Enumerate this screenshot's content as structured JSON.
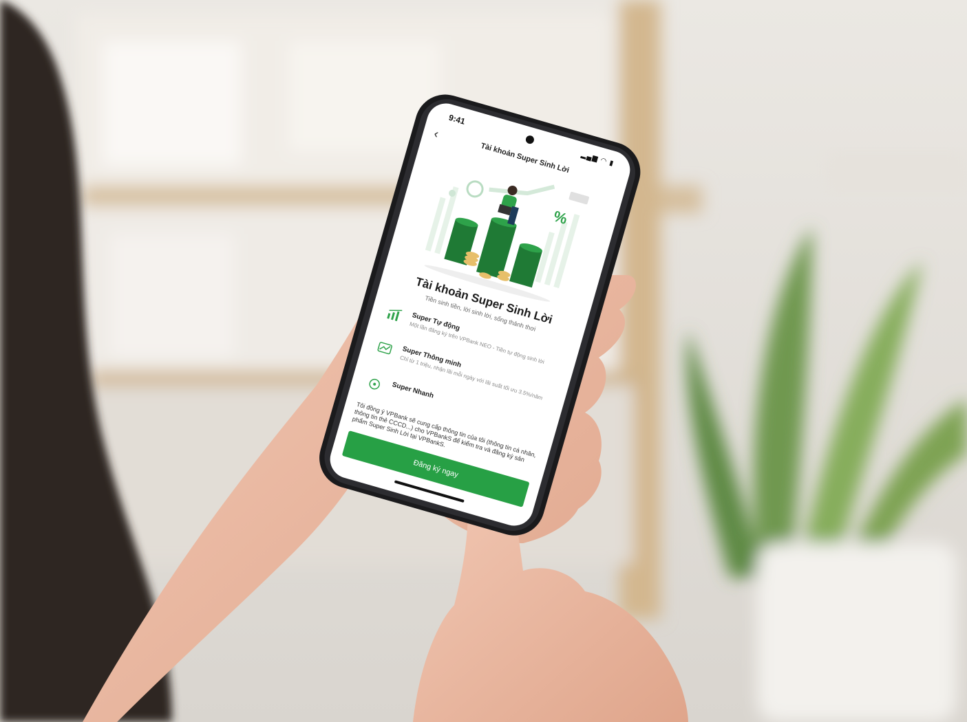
{
  "status_bar": {
    "time": "9:41",
    "indicators": "▂▄▆ ◠ ▮"
  },
  "nav": {
    "back_icon": "chevron-left",
    "title": "Tài khoản Super Sinh Lời"
  },
  "hero": {
    "illustration": "person-on-green-coin-columns-with-percent",
    "percent_text": "%"
  },
  "heading": "Tài khoản Super Sinh Lời",
  "subheading": "Tiền sinh tiền, lời sinh lời, sống thảnh thơi",
  "features": [
    {
      "icon": "auto-chart-icon",
      "title": "Super Tự động",
      "desc": "Một lần đăng ký trên VPBank NEO - Tiền tự động sinh lời"
    },
    {
      "icon": "smart-chart-icon",
      "title": "Super Thông minh",
      "desc": "Chỉ từ 1 triệu, nhận lãi mỗi ngày với lãi suất tối ưu 3.5%/năm"
    },
    {
      "icon": "speed-icon",
      "title": "Super Nhanh",
      "desc": ""
    }
  ],
  "consent_text": "Tôi đồng ý VPBank sẽ cung cấp thông tin của tôi (thông tin cá nhân, thông tin thẻ CCCD...) cho VPBankS để kiểm tra và đăng ký sản phẩm Super Sinh Lời tại VPBankS.",
  "cta_label": "Đăng ký ngay",
  "colors": {
    "brand_green": "#27a045",
    "dark_green": "#1f7a35",
    "light_green": "#dcefe1"
  }
}
